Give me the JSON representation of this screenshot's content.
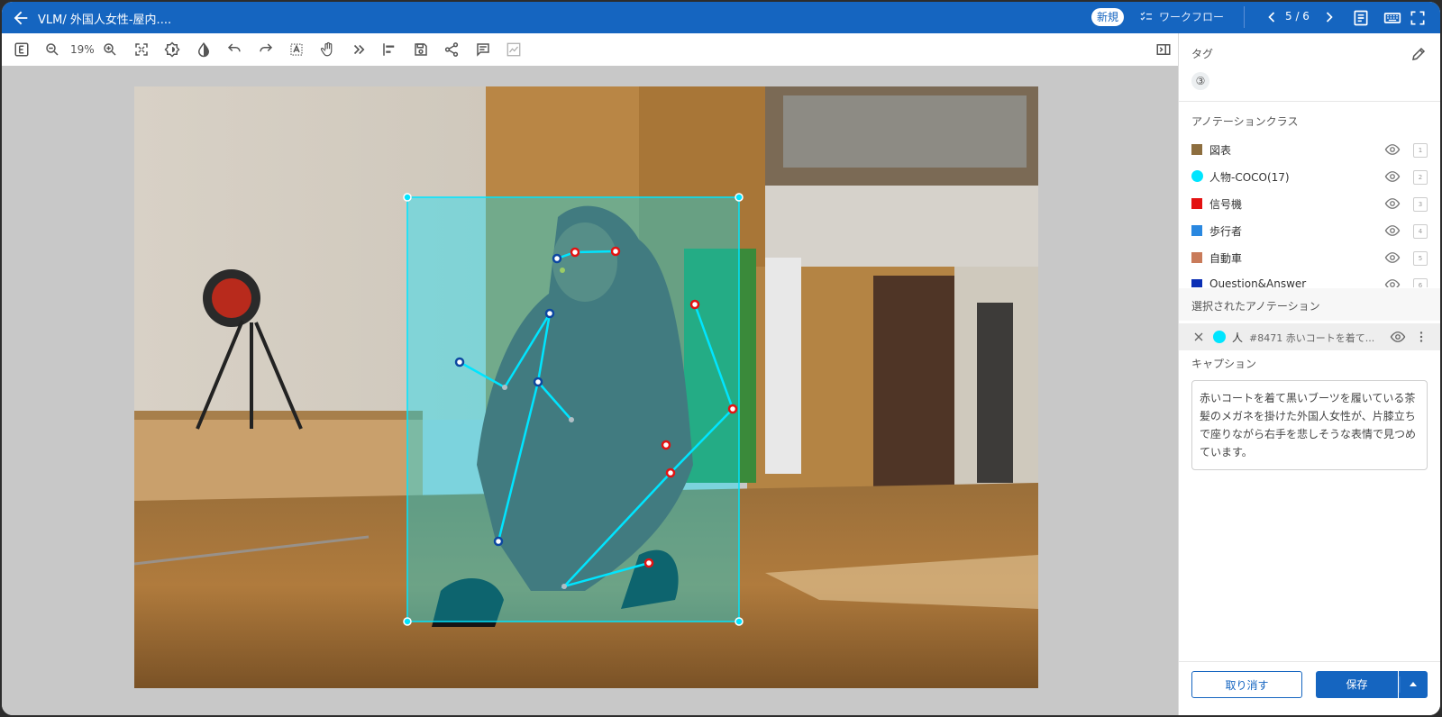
{
  "app": {
    "title": "VLM/ 外国人女性-屋内....",
    "badge": "新規",
    "workflow_label": "ワークフロー",
    "pager": "5 / 6"
  },
  "toolbar": {
    "zoom": "19%",
    "tools": [
      "e-box-icon",
      "zoom-out-icon",
      "zoom-in-icon",
      "fit-screen-icon",
      "brightness-icon",
      "contrast-icon",
      "undo-icon",
      "redo-icon",
      "text-select-icon",
      "hand-pan-icon",
      "skip-forward-icon",
      "align-left-icon",
      "save-icon",
      "share-icon",
      "comment-icon",
      "chart-icon"
    ]
  },
  "panel": {
    "tag_label": "タグ",
    "tag_count": "③",
    "class_section_label": "アノテーションクラス",
    "classes": [
      {
        "name": "図表",
        "color": "#8d6e3f",
        "shape": "square",
        "key": "1"
      },
      {
        "name": "人物-COCO(17)",
        "color": "#00e5ff",
        "shape": "circle",
        "key": "2"
      },
      {
        "name": "信号機",
        "color": "#e31212",
        "shape": "square",
        "key": "3"
      },
      {
        "name": "歩行者",
        "color": "#2a88e0",
        "shape": "square",
        "key": "4"
      },
      {
        "name": "自動車",
        "color": "#c97b5a",
        "shape": "square",
        "key": "5"
      },
      {
        "name": "Question&Answer",
        "color": "#0b2fb5",
        "shape": "square",
        "key": "6"
      }
    ],
    "selected_section_label": "選択されたアノテーション",
    "selected": {
      "class": "人",
      "id_text": "#8471  赤いコートを着て..."
    },
    "caption_label": "キャプション",
    "caption_text": "赤いコートを着て黒いブーツを履いている茶髪のメガネを掛けた外国人女性が、片膝立ちで座りながら右手を悲しそうな表情で見つめています。",
    "cancel_label": "取り消す",
    "save_label": "保存"
  },
  "colors": {
    "brand": "#1565c0",
    "annotation": "#00e5ff",
    "kp_left": "#0d47a1",
    "kp_right": "#e31212"
  }
}
